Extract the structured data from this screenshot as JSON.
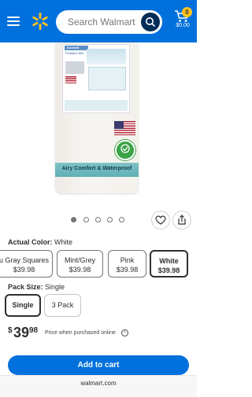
{
  "header": {
    "search_placeholder": "Search Walmart",
    "cart_count": "0",
    "cart_total": "$0.00",
    "brand_color": "#0071dc",
    "spark_color": "#ffc220",
    "menu_icon": "hamburger-icon",
    "search_icon": "search-icon",
    "cart_icon": "cart-icon"
  },
  "product": {
    "image_band_text": "Airy Comfort & Waterproof",
    "tag_brand": "Kolcraft",
    "tag_sub": "Pediatric 800",
    "image_count": 5,
    "active_image": 1
  },
  "actions": {
    "favorite_icon": "heart-icon",
    "share_icon": "share-icon"
  },
  "color": {
    "label": "Actual Color:",
    "value": "White",
    "options": [
      {
        "name": "u Gray Squares",
        "price": "$39.98"
      },
      {
        "name": "Mint/Grey",
        "price": "$39.98"
      },
      {
        "name": "Pink",
        "price": "$39.98"
      },
      {
        "name": "White",
        "price": "$39.98",
        "selected": true
      }
    ]
  },
  "size": {
    "label": "Pack Size:",
    "value": "Single",
    "options": [
      {
        "name": "Single",
        "selected": true
      },
      {
        "name": "3 Pack"
      }
    ]
  },
  "price": {
    "symbol": "$",
    "whole": "39",
    "cents": "98",
    "note": "Price when purchased online",
    "info_icon": "info-icon"
  },
  "cta": {
    "add_to_cart": "Add to cart"
  },
  "browser": {
    "url": "walmart.com"
  }
}
